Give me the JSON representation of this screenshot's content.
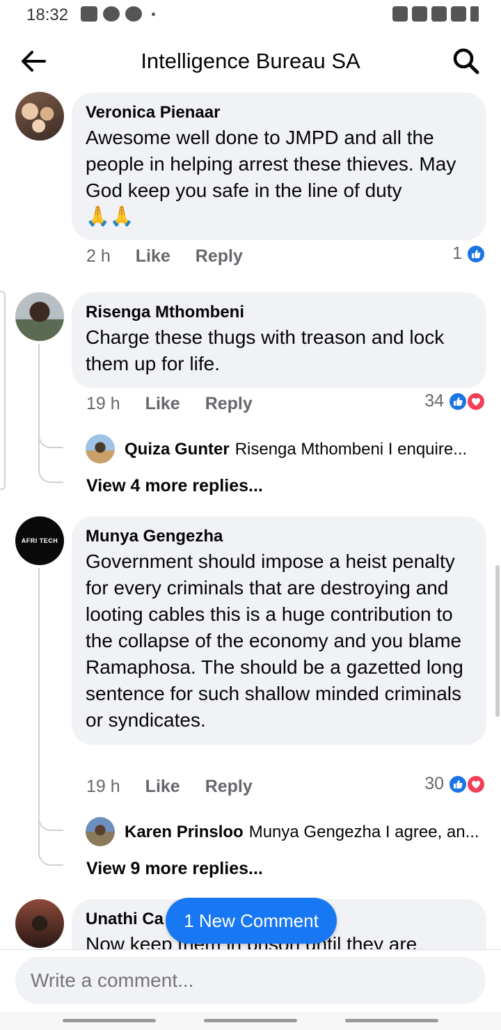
{
  "status_bar": {
    "time": "18:32"
  },
  "header": {
    "title": "Intelligence Bureau SA"
  },
  "comments": [
    {
      "author": "Veronica Pienaar",
      "text": "Awesome well done to JMPD and all the people in helping arrest these thieves. May God keep you safe in the line of duty",
      "emoji": "🙏🙏",
      "time": "2 h",
      "like_label": "Like",
      "reply_label": "Reply",
      "reaction_count": "1"
    },
    {
      "author": "Risenga Mthombeni",
      "text": "Charge these thugs with treason and lock them up for life.",
      "time": "19 h",
      "like_label": "Like",
      "reply_label": "Reply",
      "reaction_count": "34",
      "reply_preview": {
        "author": "Quiza Gunter",
        "text": "Risenga Mthombeni I enquire..."
      },
      "more_replies": "View 4 more replies..."
    },
    {
      "author": "Munya Gengezha",
      "avatar_text": "AFRI TECH",
      "text": "Government should impose a heist penalty for every criminals that  are destroying and looting cables this is a huge contribution to the collapse of the economy and you blame Ramaphosa. The should be a gazetted long sentence for such shallow minded criminals or syndicates.",
      "time": "19 h",
      "like_label": "Like",
      "reply_label": "Reply",
      "reaction_count": "30",
      "reply_preview": {
        "author": "Karen Prinsloo",
        "text": "Munya Gengezha I agree, an..."
      },
      "more_replies": "View 9 more replies..."
    },
    {
      "author": "Unathi Ca",
      "text": "Now keep them in prison until they are"
    }
  ],
  "new_comment_button": "1 New Comment",
  "composer": {
    "placeholder": "Write a comment..."
  },
  "colors": {
    "accent": "#1877f2",
    "bubble": "#f0f2f5",
    "meta": "#65676b",
    "love": "#f33e58"
  }
}
